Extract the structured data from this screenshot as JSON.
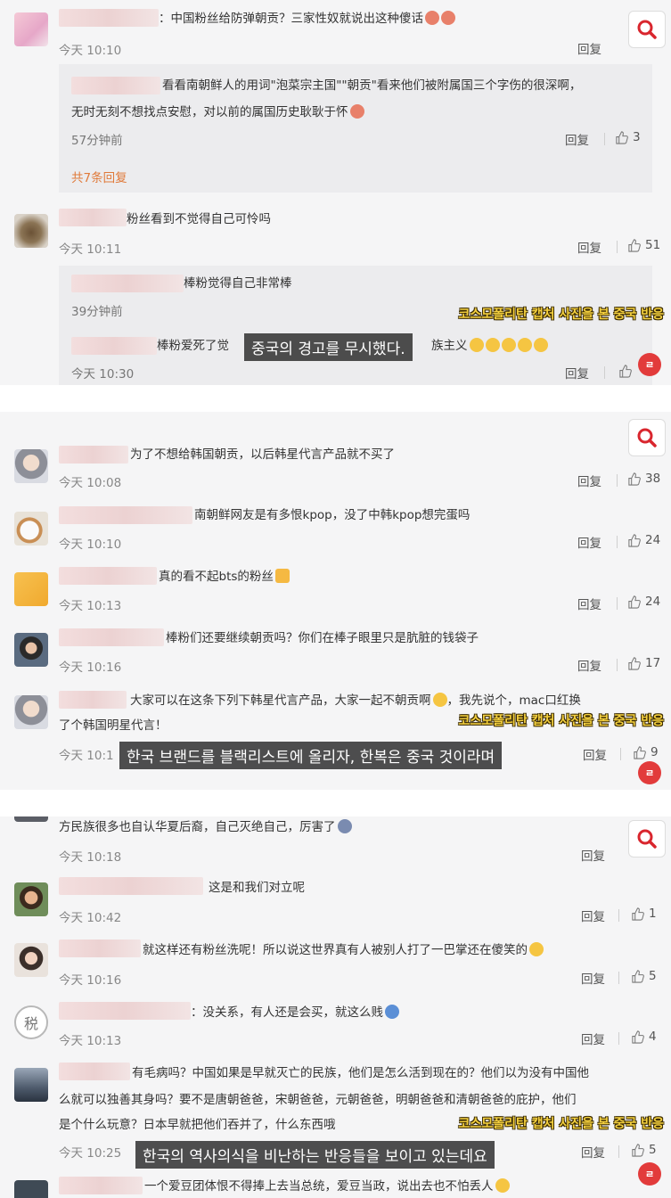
{
  "captions": {
    "source_label": "코스모폴리탄 캡처 사진을 본 중국 반응",
    "sub1": "중국의 경고를 무시했다.",
    "sub2": "한국 브랜드를 블랙리스트에 올리자, 한복은 중국 것이라며",
    "sub3": "한국의 역사의식을 비난하는 반응들을 보이고 있는데요"
  },
  "ui": {
    "reply_label": "回复",
    "search_icon": "search-icon",
    "accent": "#e07a3a",
    "badge": "#e23b3b"
  },
  "panel1": {
    "c1": {
      "text": "：中国粉丝给防弹朝贡？三家性奴就说出这种傻话",
      "time": "今天 10:10"
    },
    "sub1": {
      "text": "看看南朝鲜人的用词\"泡菜宗主国\"\"朝贡\"看来他们被附属国三个字伤的很深啊，",
      "text2": "无时无刻不想找点安慰，对以前的属国历史耿耿于怀",
      "time": "57分钟前",
      "likes": "3"
    },
    "more": "共7条回复",
    "c2": {
      "text": "粉丝看到不觉得自己可怜吗",
      "time": "今天 10:11",
      "likes": "51"
    },
    "sub2": {
      "text": "棒粉觉得自己非常棒",
      "time": "39分钟前"
    },
    "sub3": {
      "text_a": "棒粉爱死了觉",
      "text_b": "族主义",
      "time": "今天 10:30"
    }
  },
  "panel2": {
    "c0": {
      "text": "为了不想给韩国朝贡，以后韩星代言产品就不买了",
      "time": "今天 10:08",
      "likes": "38"
    },
    "c1": {
      "text": "南朝鲜网友是有多恨kpop，没了中韩kpop想完蛋吗",
      "time": "今天 10:10",
      "likes": "24"
    },
    "c2": {
      "text": "真的看不起bts的粉丝",
      "time": "今天 10:13",
      "likes": "24"
    },
    "c3": {
      "text": "棒粉们还要继续朝贡吗？你们在棒子眼里只是肮脏的钱袋子",
      "time": "今天 10:16",
      "likes": "17"
    },
    "c4": {
      "text": "大家可以在这条下列下韩星代言产品，大家一起不朝贡啊",
      "text_b": "，我先说个，mac口红换",
      "text2": "了个韩国明星代言！",
      "time": "今天 10:1",
      "likes": "9"
    }
  },
  "panel3": {
    "c0": {
      "text": "方民族很多也自认华夏后裔，自己灭绝自己，厉害了",
      "time": "今天 10:18"
    },
    "c1": {
      "text": "这是和我们对立呢",
      "time": "今天 10:42",
      "likes": "1"
    },
    "c2": {
      "text": "就这样还有粉丝洗呢！所以说这世界真有人被别人打了一巴掌还在傻笑的",
      "time": "今天 10:16",
      "likes": "5"
    },
    "c3": {
      "text": "：没关系，有人还是会买，就这么贱",
      "time": "今天 10:13",
      "likes": "4",
      "avatar_char": "税"
    },
    "c4": {
      "text": "有毛病吗？中国如果是早就灭亡的民族，他们是怎么活到现在的？他们以为没有中国他",
      "text2": "么就可以独善其身吗？要不是唐朝爸爸，宋朝爸爸，元朝爸爸，明朝爸爸和清朝爸爸的庇护，他们",
      "text3": "是个什么玩意？日本早就把他们吞并了，什么东西哦",
      "time": "今天 10:25",
      "likes": "5"
    },
    "c5": {
      "text": "一个爱豆团体恨不得捧上去当总统，爱豆当政，说出去也不怕丢人"
    }
  }
}
